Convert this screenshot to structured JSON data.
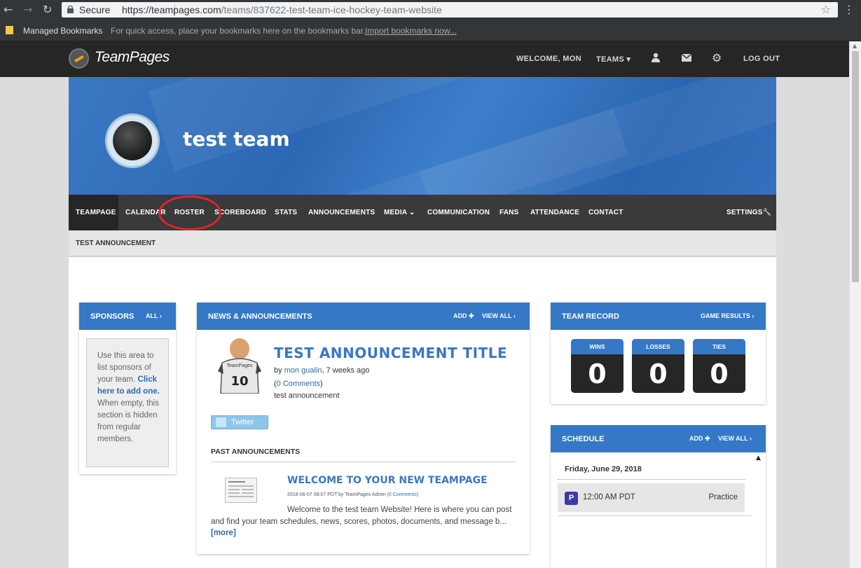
{
  "browser": {
    "secure_label": "Secure",
    "url_host": "https://teampages.com",
    "url_path": "/teams/837622-test-team-ice-hockey-team-website",
    "bookmarks_label": "Managed Bookmarks",
    "bookmarks_hint": "For quick access, place your bookmarks here on the bookmarks bar.",
    "bookmarks_link": "Import bookmarks now..."
  },
  "header": {
    "logo": "TeamPages",
    "welcome": "WELCOME, MON",
    "teams": "TEAMS ▾",
    "logout": "LOG OUT"
  },
  "team": {
    "name": "test team"
  },
  "nav": {
    "items": [
      "TEAMPAGE",
      "CALENDAR",
      "ROSTER",
      "SCOREBOARD",
      "STATS",
      "ANNOUNCEMENTS",
      "MEDIA",
      "COMMUNICATION",
      "FANS",
      "ATTENDANCE",
      "CONTACT"
    ],
    "settings": "SETTINGS",
    "subbar": "TEST ANNOUNCEMENT"
  },
  "sponsors": {
    "title": "SPONSORS",
    "all": "ALL ›",
    "text_1": "Use this area to list sponsors of your team.",
    "link": "Click here to add one.",
    "text_2": "When empty, this section is hidden from regular members."
  },
  "news": {
    "title": "NEWS & ANNOUNCEMENTS",
    "add": "ADD ✚",
    "view_all": "VIEW ALL ›",
    "headline": "TEST ANNOUNCEMENT TITLE",
    "by_prefix": "by",
    "author": "mon gualin",
    "ago": ", 7 weeks ago",
    "comments": "0 Comments",
    "body": "test announcement",
    "twitter": "Twitter",
    "past_title": "PAST ANNOUNCEMENTS",
    "past_headline": "WELCOME TO YOUR NEW TEAMPAGE",
    "past_meta": "2018-06-07 08:07 PDT by TeamPages Admin",
    "past_comments": "(0 Comments)",
    "past_body": "Welcome to the test team Website! Here is where you can post and find your team schedules, news, scores, photos, documents, and message b...",
    "more": "[more]"
  },
  "record": {
    "title": "TEAM RECORD",
    "game_results": "GAME RESULTS ›",
    "wins_label": "WINS",
    "wins": "0",
    "losses_label": "LOSSES",
    "losses": "0",
    "ties_label": "TIES",
    "ties": "0"
  },
  "schedule": {
    "title": "SCHEDULE",
    "add": "ADD ✚",
    "view_all": "VIEW ALL ›",
    "date": "Friday, June 29, 2018",
    "badge": "P",
    "time": "12:00 AM PDT",
    "type": "Practice"
  },
  "colors": {
    "brand_blue": "#3478c6",
    "header_dark": "#262626",
    "nav_dark": "#3a3a3a",
    "highlight_red": "#e0242c"
  }
}
